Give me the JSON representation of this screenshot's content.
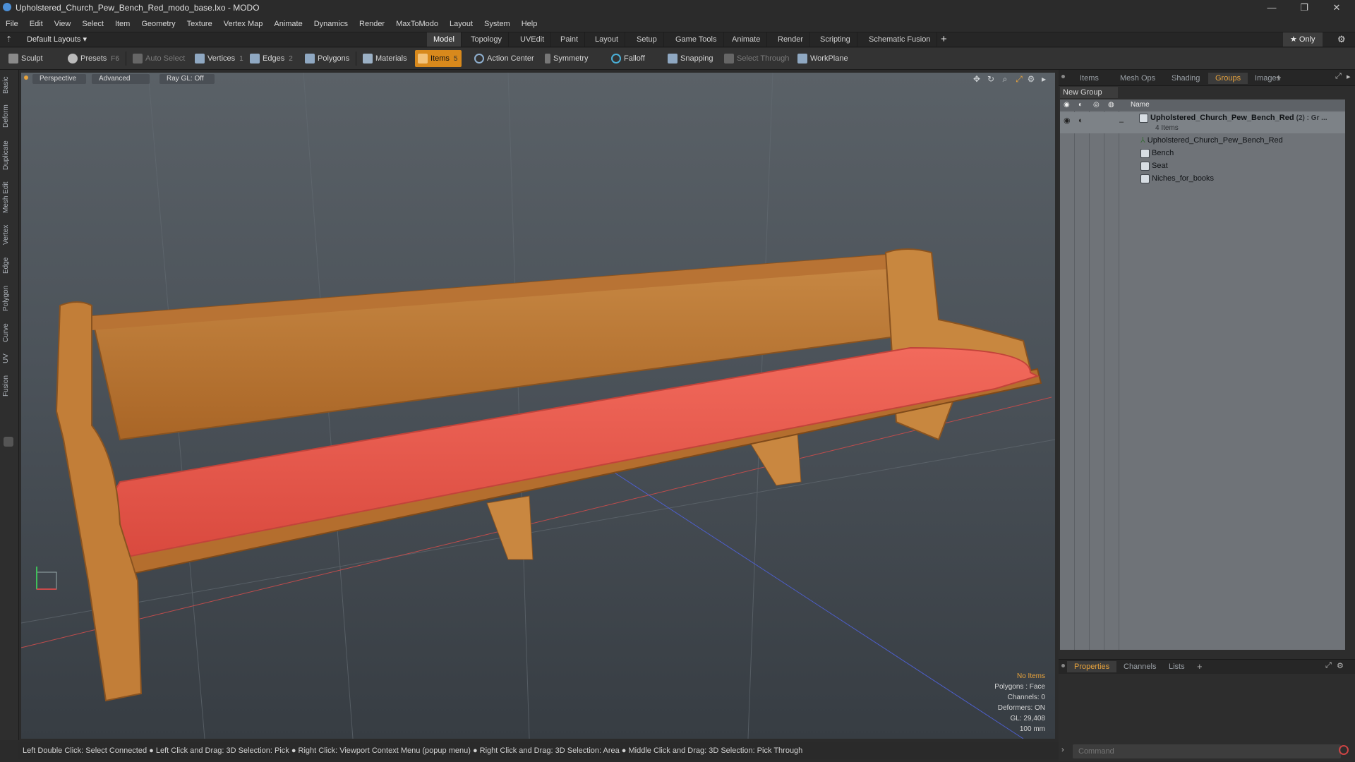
{
  "window": {
    "title": "Upholstered_Church_Pew_Bench_Red_modo_base.lxo - MODO",
    "controls": [
      "—",
      "❐",
      "✕"
    ]
  },
  "menu": [
    "File",
    "Edit",
    "View",
    "Select",
    "Item",
    "Geometry",
    "Texture",
    "Vertex Map",
    "Animate",
    "Dynamics",
    "Render",
    "MaxToModo",
    "Layout",
    "System",
    "Help"
  ],
  "layout_bar": {
    "layout_selector": "Default Layouts ▾",
    "tabs": [
      "Model",
      "Topology",
      "UVEdit",
      "Paint",
      "Layout",
      "Setup",
      "Game Tools",
      "Animate",
      "Render",
      "Scripting",
      "Schematic Fusion"
    ],
    "active_tab": "Model",
    "add": "+",
    "only_label": "★  Only",
    "gear": "⚙"
  },
  "toolbar": {
    "sculpt": "Sculpt",
    "presets": "Presets",
    "presets_key": "F6",
    "auto_select": "Auto Select",
    "vertices": "Vertices",
    "vertices_key": "1",
    "edges": "Edges",
    "edges_key": "2",
    "polygons": "Polygons",
    "materials": "Materials",
    "items": "Items",
    "items_key": "5",
    "action_center": "Action Center",
    "symmetry": "Symmetry",
    "falloff": "Falloff",
    "snapping": "Snapping",
    "select_through": "Select Through",
    "workplane": "WorkPlane"
  },
  "left_tabs": [
    "Basic",
    "Deform",
    "Duplicate",
    "Mesh Edit",
    "Vertex",
    "Edge",
    "Polygon",
    "Curve",
    "UV",
    "Fusion"
  ],
  "viewport": {
    "view": "Perspective",
    "shading": "Advanced",
    "raygl": "Ray GL: Off",
    "stats": {
      "selection": "No Items",
      "polygons": "Polygons : Face",
      "channels": "Channels: 0",
      "deformers": "Deformers: ON",
      "gl": "GL: 29,408",
      "unit": "100 mm"
    }
  },
  "status_bar": "Left Double Click: Select Connected ● Left Click and Drag: 3D Selection: Pick ● Right Click: Viewport Context Menu (popup menu) ● Right Click and Drag: 3D Selection: Area ● Middle Click and Drag: 3D Selection: Pick Through",
  "right_panel": {
    "tabs": [
      "Items",
      "Mesh Ops",
      "Shading",
      "Groups",
      "Images"
    ],
    "active_tab": "Groups",
    "add": "+",
    "new_group": "New Group",
    "tree_header": "Name",
    "group": {
      "name": "Upholstered_Church_Pew_Bench_Red",
      "suffix": "(2) : Gr ...",
      "subtitle": "4 Items"
    },
    "children": [
      "Upholstered_Church_Pew_Bench_Red",
      "Bench",
      "Seat",
      "Niches_for_books"
    ],
    "bottom_tabs": [
      "Properties",
      "Channels",
      "Lists"
    ],
    "bottom_active": "Properties",
    "command_placeholder": "Command"
  },
  "colors": {
    "accent": "#d8891c",
    "active_text": "#e8a33c",
    "cushion": "#e9594c",
    "wood": "#c27a35"
  }
}
